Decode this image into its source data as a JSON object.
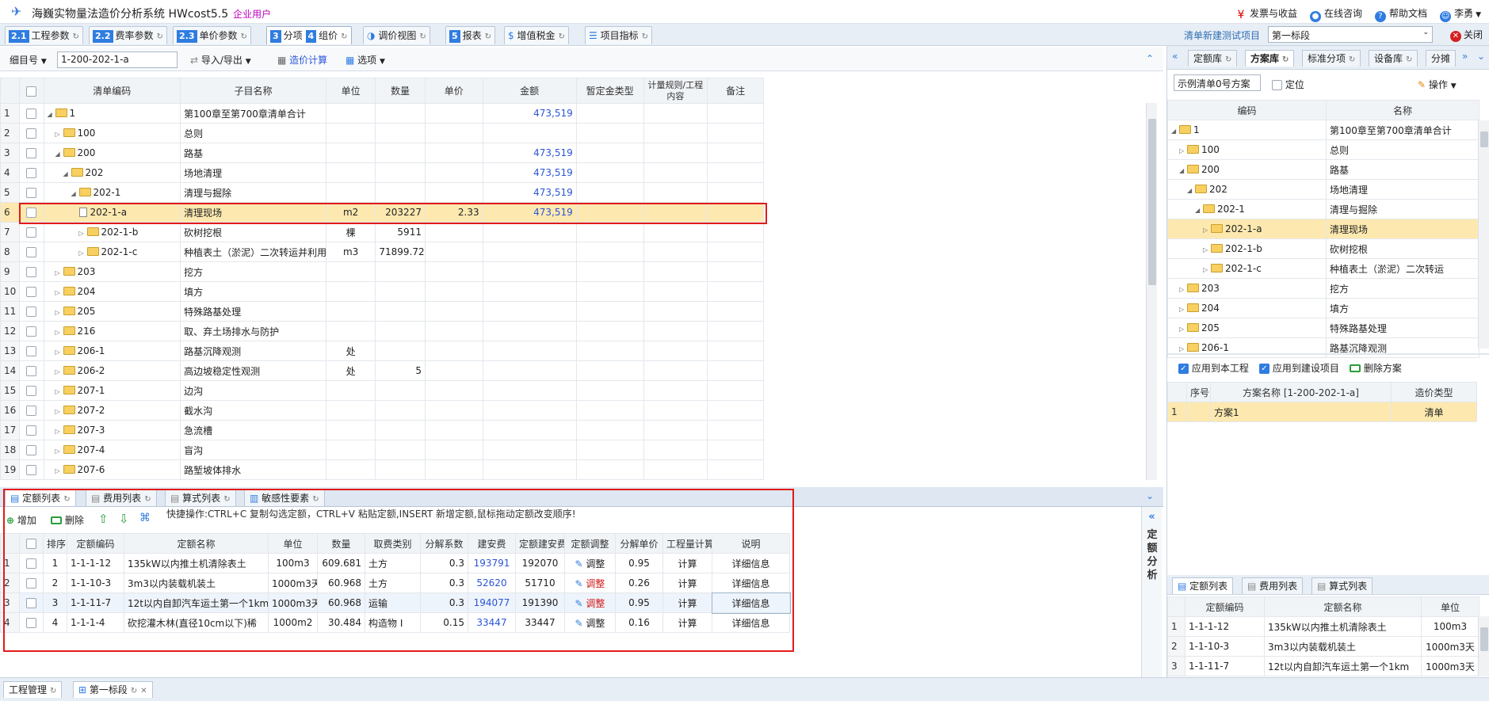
{
  "titlebar": {
    "title": "海巍实物量法造价分析系统 HWcost5.5",
    "edition": "企业用户",
    "links": [
      "发票与收益",
      "在线咨询",
      "帮助文档",
      "李勇"
    ]
  },
  "main_tabs": [
    {
      "num": "2.1",
      "label": "工程参数"
    },
    {
      "num": "2.2",
      "label": "费率参数"
    },
    {
      "num": "2.3",
      "label": "单价参数"
    },
    {
      "num": "3",
      "label": "分项",
      "num2": "4",
      "label2": "组价"
    },
    {
      "num": "",
      "label": "调价视图"
    },
    {
      "num": "5",
      "label": "报表"
    },
    {
      "num": "",
      "label": "增值税金"
    },
    {
      "num": "",
      "label": "项目指标"
    }
  ],
  "project": {
    "label": "清单新建测试项目",
    "section": "第一标段",
    "close": "关闭"
  },
  "toolbar": {
    "filter_label": "细目号",
    "filter_value": "1-200-202-1-a",
    "import_export": "导入/导出",
    "calc": "造价计算",
    "options": "选项"
  },
  "main_grid": {
    "headers": [
      "清单编码",
      "子目名称",
      "单位",
      "数量",
      "单价",
      "金额",
      "暂定金类型",
      "计量规则/工程内容",
      "备注"
    ],
    "rows": [
      {
        "n": "1",
        "code": "1",
        "name": "第100章至第700章清单合计",
        "unit": "",
        "qty": "",
        "price": "",
        "amount": "473,519"
      },
      {
        "n": "2",
        "code": "100",
        "name": "总则",
        "unit": "",
        "qty": "",
        "price": "",
        "amount": ""
      },
      {
        "n": "3",
        "code": "200",
        "name": "路基",
        "unit": "",
        "qty": "",
        "price": "",
        "amount": "473,519"
      },
      {
        "n": "4",
        "code": "202",
        "name": "场地清理",
        "unit": "",
        "qty": "",
        "price": "",
        "amount": "473,519"
      },
      {
        "n": "5",
        "code": "202-1",
        "name": "清理与掘除",
        "unit": "",
        "qty": "",
        "price": "",
        "amount": "473,519"
      },
      {
        "n": "6",
        "code": "202-1-a",
        "name": "清理现场",
        "unit": "m2",
        "qty": "203227",
        "price": "2.33",
        "amount": "473,519"
      },
      {
        "n": "7",
        "code": "202-1-b",
        "name": "砍树挖根",
        "unit": "棵",
        "qty": "5911",
        "price": "",
        "amount": ""
      },
      {
        "n": "8",
        "code": "202-1-c",
        "name": "种植表土（淤泥）二次转运并利用",
        "unit": "m3",
        "qty": "71899.72",
        "price": "",
        "amount": ""
      },
      {
        "n": "9",
        "code": "203",
        "name": "挖方",
        "unit": "",
        "qty": "",
        "price": "",
        "amount": ""
      },
      {
        "n": "10",
        "code": "204",
        "name": "填方",
        "unit": "",
        "qty": "",
        "price": "",
        "amount": ""
      },
      {
        "n": "11",
        "code": "205",
        "name": "特殊路基处理",
        "unit": "",
        "qty": "",
        "price": "",
        "amount": ""
      },
      {
        "n": "12",
        "code": "216",
        "name": "取、弃土场排水与防护",
        "unit": "",
        "qty": "",
        "price": "",
        "amount": ""
      },
      {
        "n": "13",
        "code": "206-1",
        "name": "路基沉降观测",
        "unit": "处",
        "qty": "",
        "price": "",
        "amount": ""
      },
      {
        "n": "14",
        "code": "206-2",
        "name": "高边坡稳定性观测",
        "unit": "处",
        "qty": "5",
        "price": "",
        "amount": ""
      },
      {
        "n": "15",
        "code": "207-1",
        "name": "边沟",
        "unit": "",
        "qty": "",
        "price": "",
        "amount": ""
      },
      {
        "n": "16",
        "code": "207-2",
        "name": "截水沟",
        "unit": "",
        "qty": "",
        "price": "",
        "amount": ""
      },
      {
        "n": "17",
        "code": "207-3",
        "name": "急流槽",
        "unit": "",
        "qty": "",
        "price": "",
        "amount": ""
      },
      {
        "n": "18",
        "code": "207-4",
        "name": "盲沟",
        "unit": "",
        "qty": "",
        "price": "",
        "amount": ""
      },
      {
        "n": "19",
        "code": "207-6",
        "name": "路堑坡体排水",
        "unit": "",
        "qty": "",
        "price": "",
        "amount": ""
      }
    ]
  },
  "bottom_tabs": [
    "定额列表",
    "费用列表",
    "算式列表",
    "敏感性要素"
  ],
  "bottom_toolbar": {
    "add": "增加",
    "delete": "删除",
    "hint": "快捷操作:CTRL+C 复制勾选定额，CTRL+V 粘贴定额,INSERT 新增定额,鼠标拖动定额改变顺序!"
  },
  "quota_grid": {
    "headers": [
      "排序",
      "定额编码",
      "定额名称",
      "单位",
      "数量",
      "取费类别",
      "分解系数",
      "建安费",
      "定额建安费",
      "定额调整",
      "分解单价",
      "工程量计算",
      "说明"
    ],
    "rows": [
      {
        "n": "1",
        "order": "1",
        "code": "1-1-1-12",
        "name": "135kW以内推土机清除表土",
        "unit": "100m3",
        "qty": "609.681",
        "cat": "土方",
        "coef": "0.3",
        "fee": "193791",
        "qfee": "192070",
        "adj": "调整",
        "adj_red": false,
        "up": "0.95",
        "calc": "计算",
        "info": "详细信息"
      },
      {
        "n": "2",
        "order": "2",
        "code": "1-1-10-3",
        "name": "3m3以内装载机装土",
        "unit": "1000m3天",
        "qty": "60.968",
        "cat": "土方",
        "coef": "0.3",
        "fee": "52620",
        "qfee": "51710",
        "adj": "调整",
        "adj_red": true,
        "up": "0.26",
        "calc": "计算",
        "info": "详细信息"
      },
      {
        "n": "3",
        "order": "3",
        "code": "1-1-11-7",
        "name": "12t以内自卸汽车运土第一个1km",
        "unit": "1000m3天",
        "qty": "60.968",
        "cat": "运输",
        "coef": "0.3",
        "fee": "194077",
        "qfee": "191390",
        "adj": "调整",
        "adj_red": true,
        "up": "0.95",
        "calc": "计算",
        "info": "详细信息"
      },
      {
        "n": "4",
        "order": "4",
        "code": "1-1-1-4",
        "name": "砍挖灌木林(直径10cm以下)稀",
        "unit": "1000m2",
        "qty": "30.484",
        "cat": "构造物 I",
        "coef": "0.15",
        "fee": "33447",
        "qfee": "33447",
        "adj": "调整",
        "adj_red": false,
        "up": "0.16",
        "calc": "计算",
        "info": "详细信息"
      }
    ]
  },
  "side_label": "定额分析",
  "right_panel": {
    "tabs": [
      "定额库",
      "方案库",
      "标准分项",
      "设备库",
      "分摊"
    ],
    "scheme_select": "示例清单0号方案",
    "locate": "定位",
    "operate": "操作",
    "tree_headers": [
      "编码",
      "名称"
    ],
    "tree": [
      {
        "code": "1",
        "name": "第100章至第700章清单合计"
      },
      {
        "code": "100",
        "name": "总则"
      },
      {
        "code": "200",
        "name": "路基"
      },
      {
        "code": "202",
        "name": "场地清理"
      },
      {
        "code": "202-1",
        "name": "清理与掘除"
      },
      {
        "code": "202-1-a",
        "name": "清理现场"
      },
      {
        "code": "202-1-b",
        "name": "砍树挖根"
      },
      {
        "code": "202-1-c",
        "name": "种植表土（淤泥）二次转运"
      },
      {
        "code": "203",
        "name": "挖方"
      },
      {
        "code": "204",
        "name": "填方"
      },
      {
        "code": "205",
        "name": "特殊路基处理"
      },
      {
        "code": "206-1",
        "name": "路基沉降观测"
      }
    ],
    "apply_project": "应用到本工程",
    "apply_build": "应用到建设项目",
    "delete_scheme": "删除方案",
    "scheme_headers": [
      "序号",
      "方案名称 [1-200-202-1-a]",
      "造价类型"
    ],
    "schemes": [
      {
        "n": "1",
        "name": "方案1",
        "type": "清单"
      }
    ],
    "bottom_tabs": [
      "定额列表",
      "费用列表",
      "算式列表"
    ],
    "quota_headers": [
      "定额编码",
      "定额名称",
      "单位"
    ],
    "quotas": [
      {
        "n": "1",
        "code": "1-1-1-12",
        "name": "135kW以内推土机清除表土",
        "unit": "100m3"
      },
      {
        "n": "2",
        "code": "1-1-10-3",
        "name": "3m3以内装载机装土",
        "unit": "1000m3天"
      },
      {
        "n": "3",
        "code": "1-1-11-7",
        "name": "12t以内自卸汽车运土第一个1km",
        "unit": "1000m3天"
      }
    ]
  },
  "status_tabs": [
    "工程管理",
    "第一标段"
  ]
}
